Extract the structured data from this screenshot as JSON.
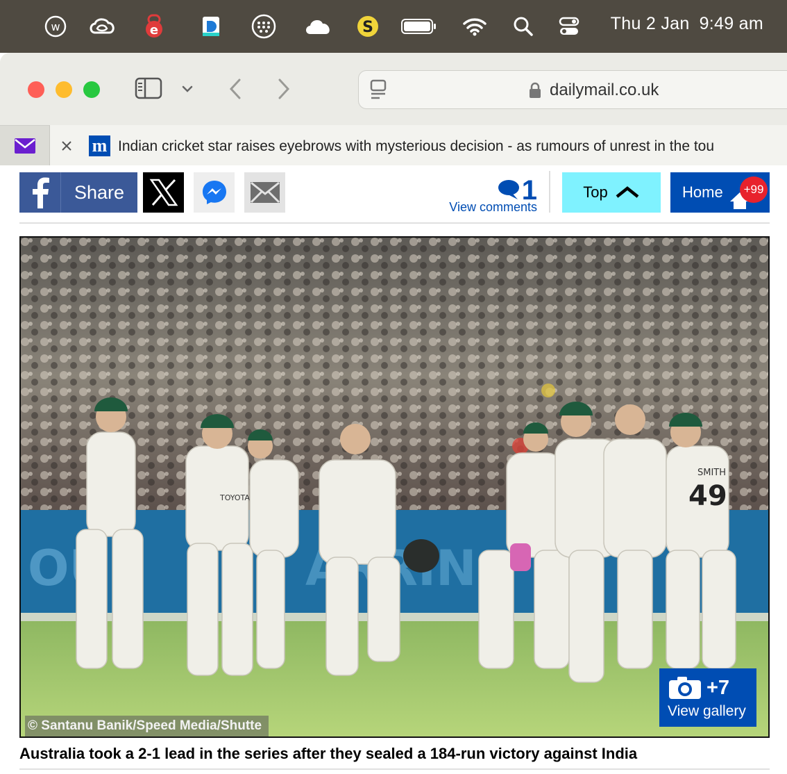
{
  "menubar": {
    "date": "Thu 2 Jan",
    "time": "9:49 am",
    "icons": [
      "w-app-icon",
      "creative-cloud-icon",
      "e-app-icon",
      "d-app-icon",
      "grid-dots-icon",
      "cloud-icon",
      "s-app-icon",
      "battery-icon",
      "wifi-icon",
      "spotlight-search-icon",
      "control-center-icon"
    ]
  },
  "browser": {
    "url": "dailymail.co.uk",
    "tab_title": "Indian cricket star raises eyebrows with mysterious decision - as rumours of unrest in the tou",
    "favicon_letter": "m"
  },
  "sharebar": {
    "share_label": "Share",
    "comments_count": "1",
    "comments_label": "View comments",
    "top_label": "Top",
    "home_label": "Home",
    "home_badge": "+99"
  },
  "article": {
    "photo_credit": "© Santanu Banik/Speed Media/Shutte",
    "gallery_count": "+7",
    "gallery_label": "View gallery",
    "caption": "Australia took a 2-1 lead in the series after they sealed a 184-run victory against India",
    "photo_player_name": "SMITH",
    "photo_player_number": "49",
    "photo_sponsor": "TOYOTA"
  },
  "colors": {
    "menubar_bg": "#4f4a41",
    "facebook_blue": "#3b5998",
    "dm_blue": "#004db3",
    "top_cyan": "#7ff2ff",
    "badge_red": "#e8222c"
  }
}
